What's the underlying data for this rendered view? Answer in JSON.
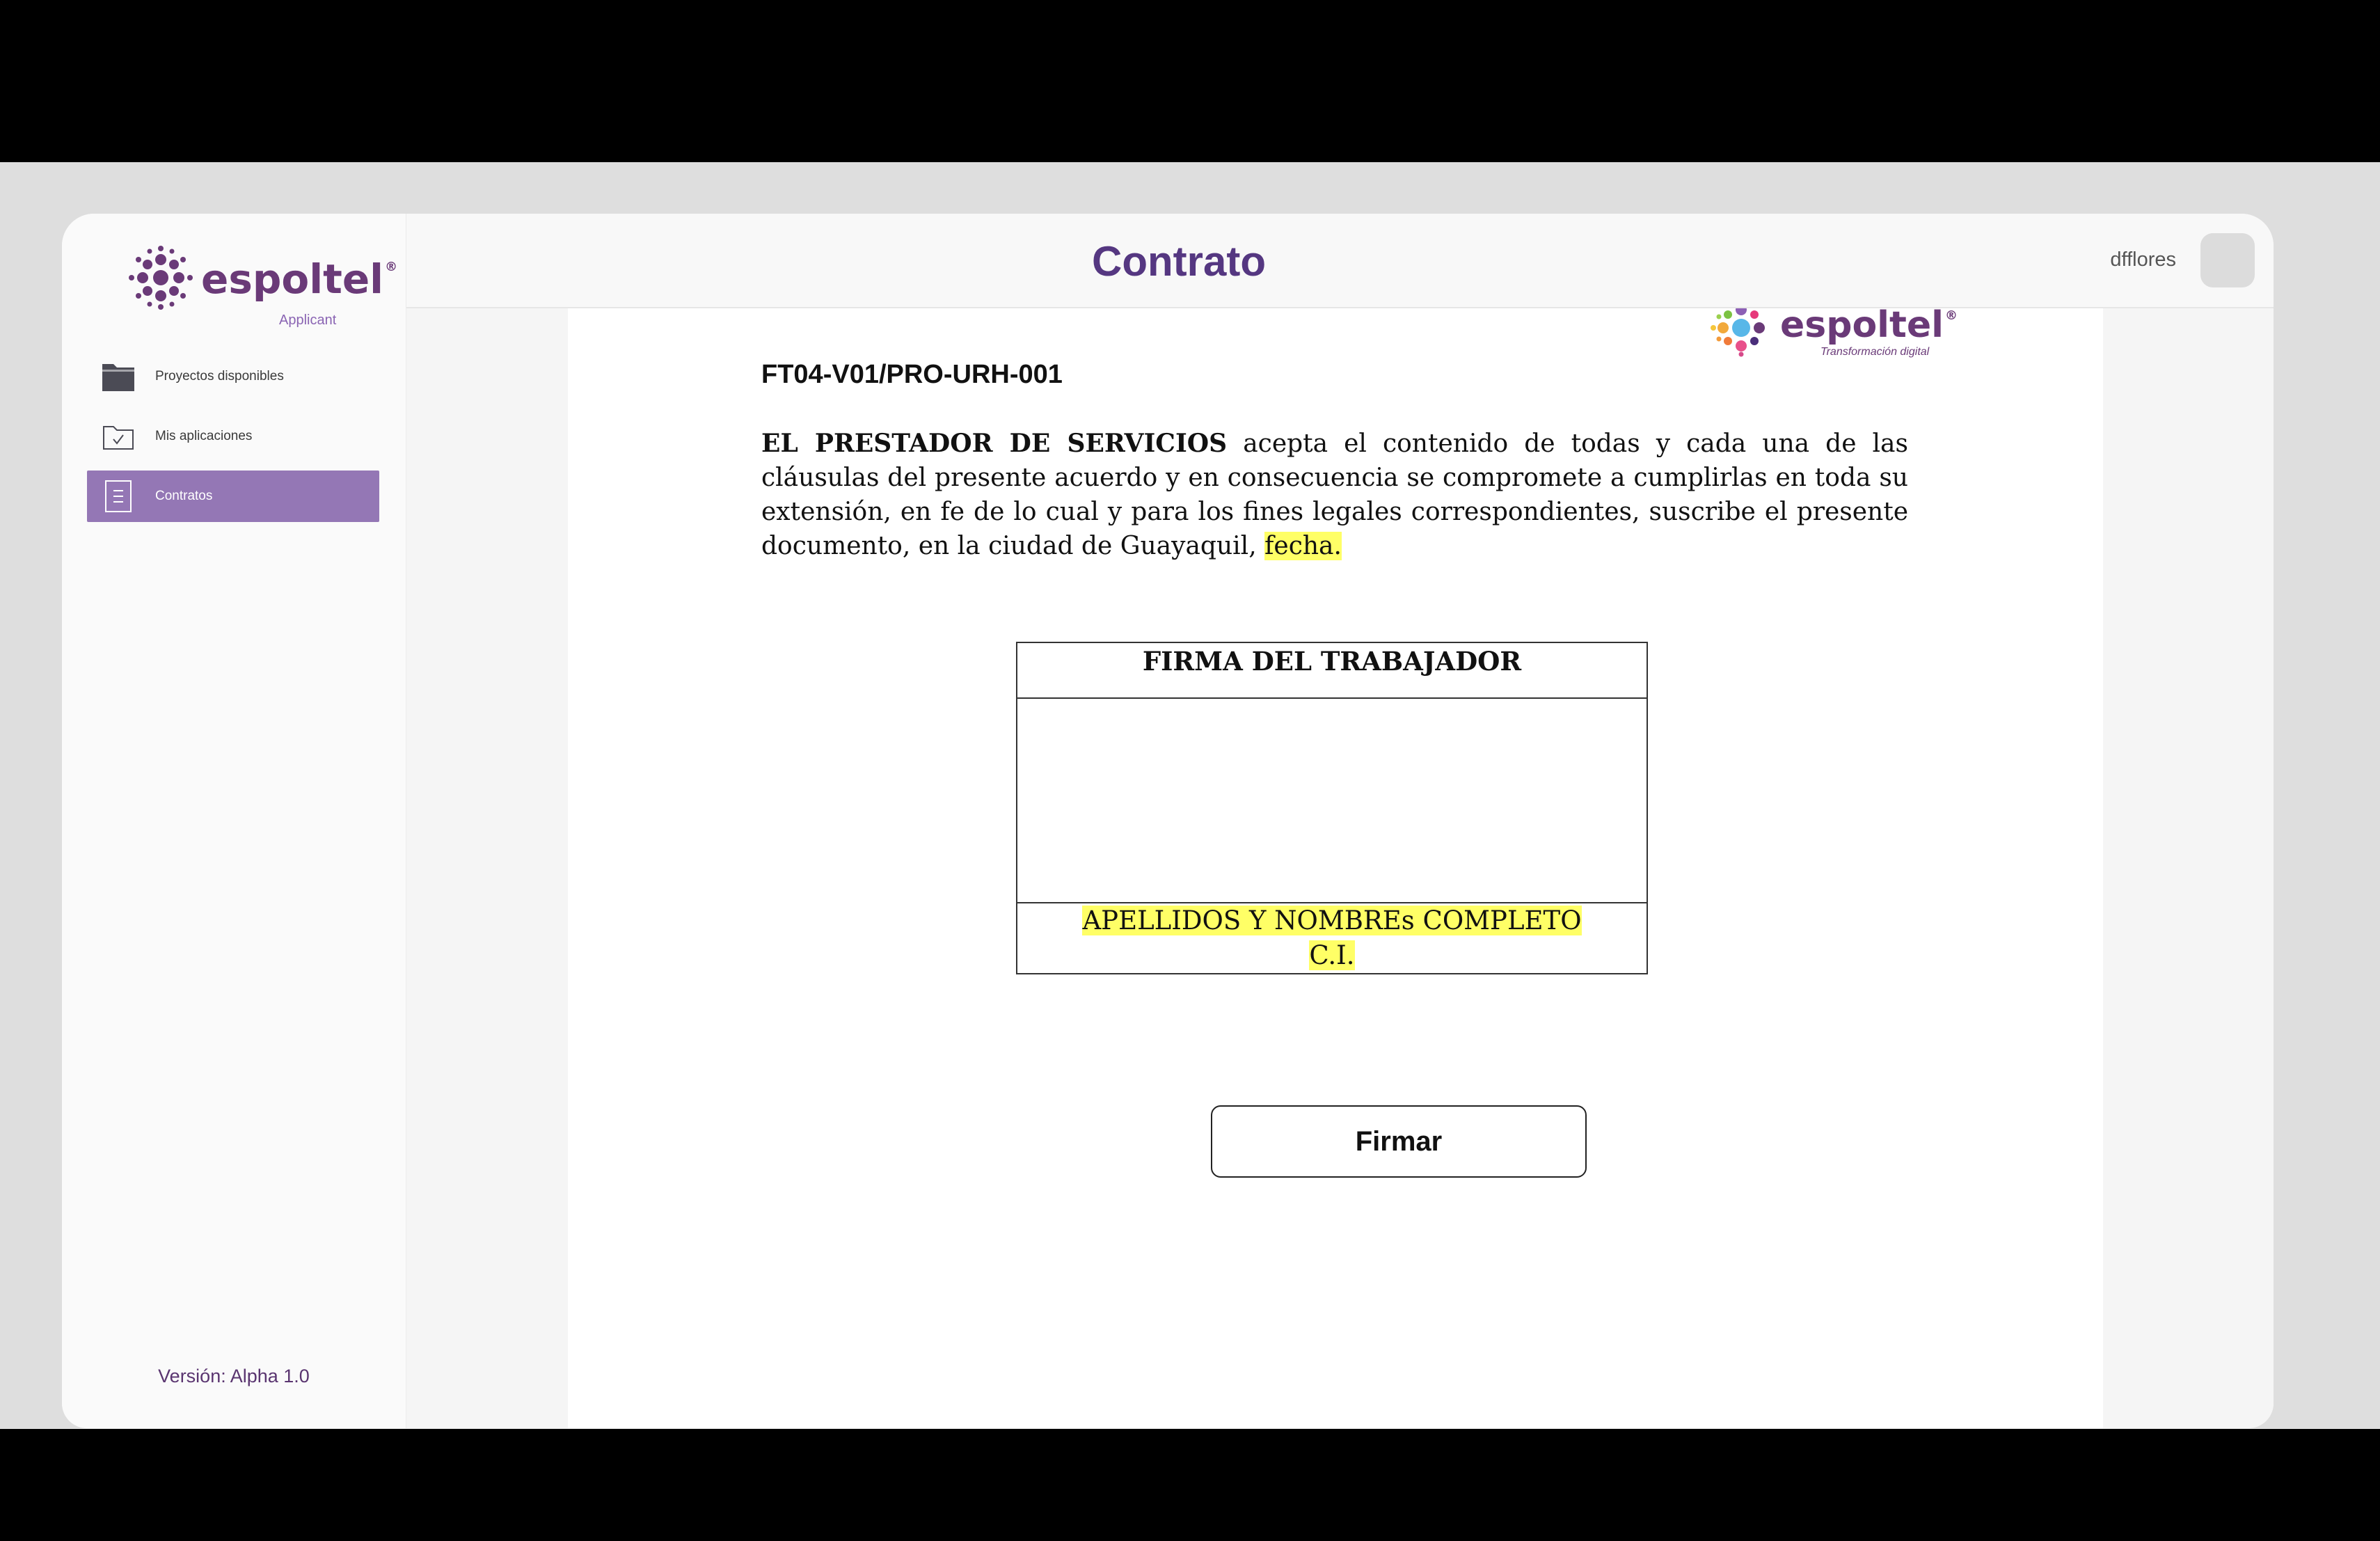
{
  "brand": {
    "name": "espoltel",
    "registered": "®",
    "subtitle": "Applicant"
  },
  "sidebar": {
    "items": [
      {
        "label": "Proyectos disponibles",
        "icon": "folder-icon",
        "active": false
      },
      {
        "label": "Mis aplicaciones",
        "icon": "folder-check-icon",
        "active": false
      },
      {
        "label": "Contratos",
        "icon": "document-list-icon",
        "active": true
      }
    ],
    "version": "Versión: Alpha 1.0"
  },
  "header": {
    "title": "Contrato",
    "username": "dfflores"
  },
  "document": {
    "logo_name": "espoltel",
    "logo_registered": "®",
    "logo_subtitle": "Transformación digital",
    "code": "FT04-V01/PRO-URH-001",
    "paragraph": {
      "lead_bold": "EL PRESTADOR DE SERVICIOS",
      "body": " acepta el contenido de todas y cada una de las cláusulas del presente acuerdo y en consecuencia se compromete a cumplirlas en toda su extensión, en fe de lo cual y para los fines legales correspondientes, suscribe el presente documento, en la ciudad de Guayaquil, ",
      "highlight": "fecha."
    },
    "signature_table": {
      "header": "FIRMA DEL TRABAJADOR",
      "name_line": "APELLIDOS Y NOMBREs COMPLETO",
      "id_line": "C.I."
    }
  },
  "actions": {
    "sign_label": "Firmar"
  },
  "colors": {
    "brand_purple": "#553781",
    "active_nav": "#9477b5",
    "highlight": "#ffff66"
  }
}
